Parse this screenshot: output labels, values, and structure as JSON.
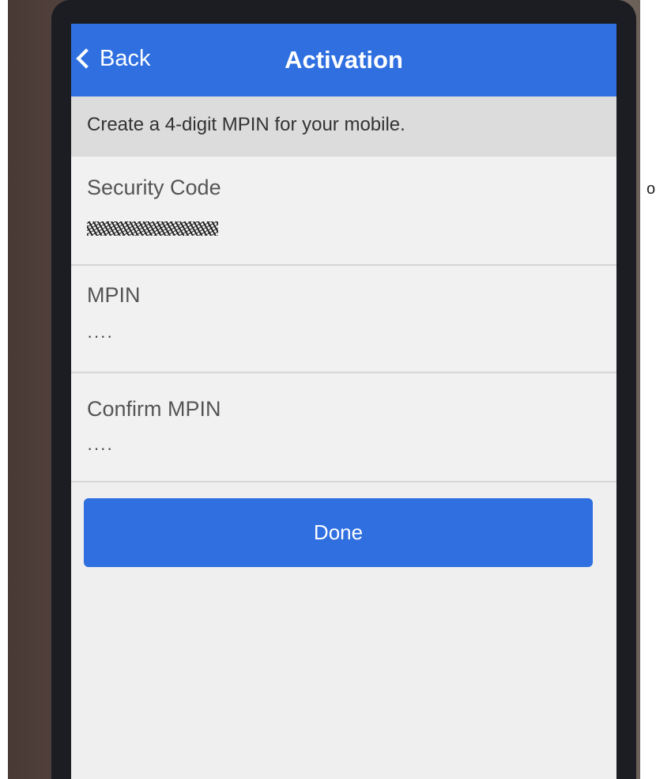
{
  "stray_char": "o",
  "nav": {
    "back_label": "Back",
    "title": "Activation"
  },
  "instruction": "Create a 4-digit MPIN for your mobile.",
  "fields": {
    "security_code": {
      "label": "Security Code",
      "value_redacted": true
    },
    "mpin": {
      "label": "MPIN",
      "value": "····"
    },
    "confirm_mpin": {
      "label": "Confirm MPIN",
      "value": "····"
    }
  },
  "done_label": "Done",
  "colors": {
    "accent": "#2f6fe0",
    "screen_bg": "#efefef",
    "instruction_bg": "#dcdcdc"
  },
  "icons": {
    "back": "chevron-left-icon"
  }
}
